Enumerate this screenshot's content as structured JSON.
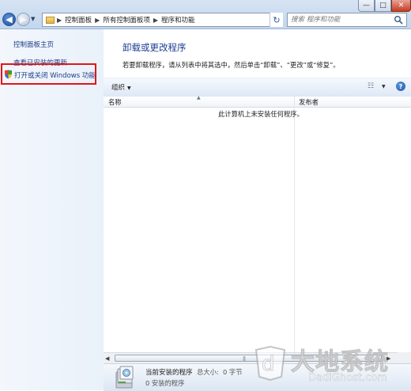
{
  "window": {
    "minimize_glyph": "—",
    "maximize_glyph": "□",
    "close_glyph": "✕"
  },
  "nav": {
    "back_glyph": "◀",
    "forward_glyph": "▶",
    "history_glyph": "▼",
    "breadcrumb": [
      "控制面板",
      "所有控制面板项",
      "程序和功能"
    ],
    "separator": "▶",
    "refresh_glyph": "↻"
  },
  "search": {
    "placeholder": "搜索 程序和功能",
    "icon": "search-icon"
  },
  "sidebar": {
    "items": [
      {
        "label": "控制面板主页"
      },
      {
        "label": "查看已安装的更新"
      },
      {
        "label": "打开或关闭 Windows 功能",
        "icon": "shield-icon"
      }
    ],
    "highlight_color": "#e0161b"
  },
  "main": {
    "title": "卸载或更改程序",
    "description": "若要卸载程序，请从列表中将其选中，然后单击“卸载”、“更改”或“修复”。"
  },
  "toolbar": {
    "organize_label": "组织",
    "dropdown_glyph": "▼",
    "view_glyph": "☷",
    "help_glyph": "?"
  },
  "list": {
    "columns": [
      "名称",
      "发布者"
    ],
    "empty_message": "此计算机上未安装任何程序。"
  },
  "details": {
    "label": "当前安装的程序",
    "size_label": "总大小:",
    "size_value": "0 字节",
    "count": "0 安装的程序"
  },
  "watermark": {
    "text_cn": "大地系统",
    "text_en": "DadiGhost.com"
  },
  "colors": {
    "title_blue": "#1e3e94",
    "link_blue": "#1f3f87",
    "highlight_red": "#e0161b"
  }
}
